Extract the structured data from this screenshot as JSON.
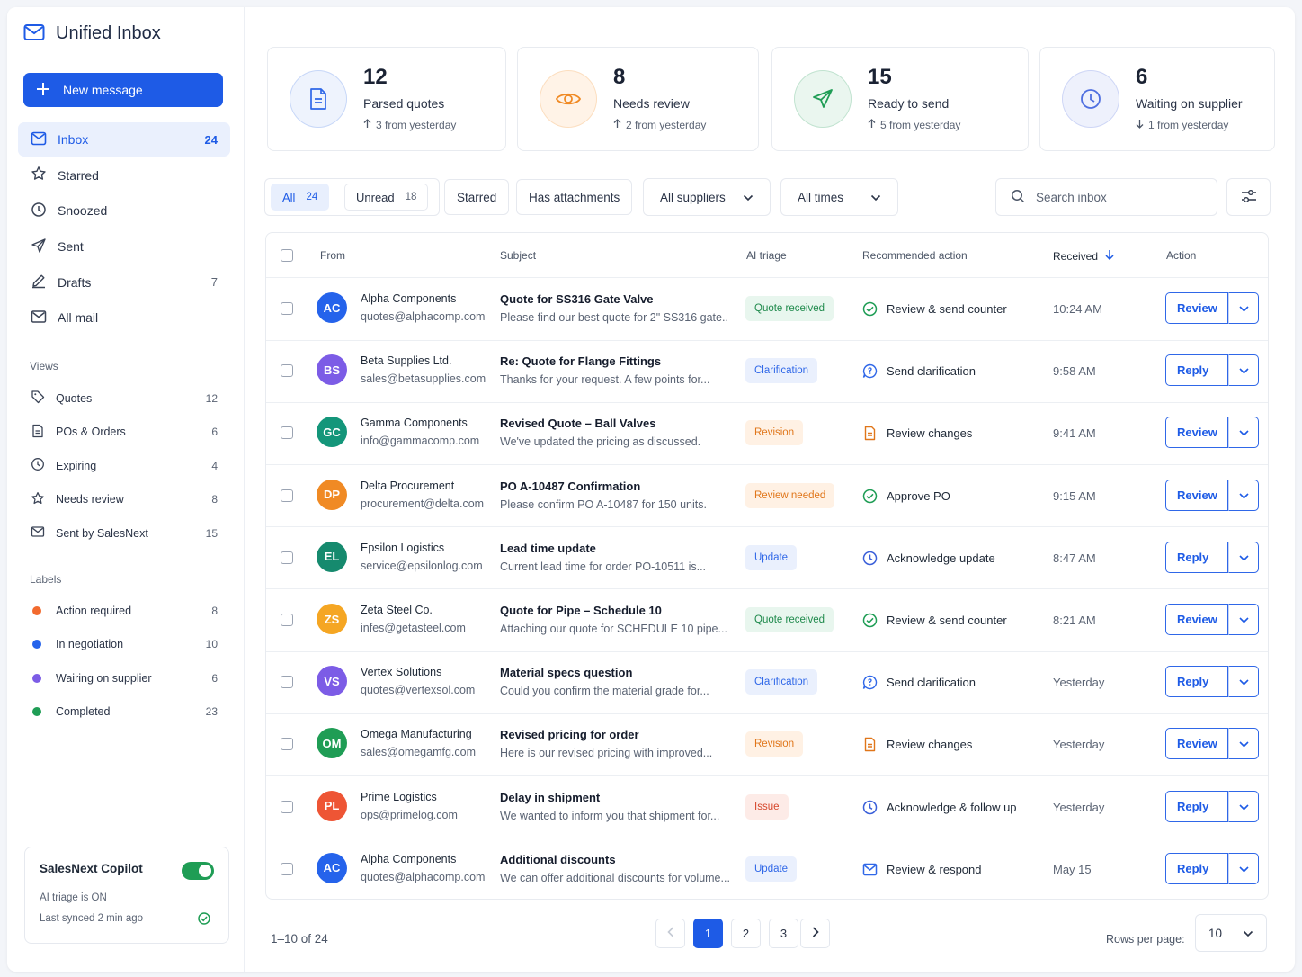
{
  "app": {
    "title": "Unified Inbox",
    "new_message": "New message"
  },
  "nav": [
    {
      "label": "Inbox",
      "count": "24",
      "icon": "inbox-icon"
    },
    {
      "label": "Starred",
      "count": "",
      "icon": "star-icon"
    },
    {
      "label": "Snoozed",
      "count": "",
      "icon": "clock-icon"
    },
    {
      "label": "Sent",
      "count": "",
      "icon": "send-icon"
    },
    {
      "label": "Drafts",
      "count": "7",
      "icon": "pencil-icon"
    },
    {
      "label": "All mail",
      "count": "",
      "icon": "mail-icon"
    }
  ],
  "views": {
    "title": "Views",
    "items": [
      {
        "label": "Quotes",
        "count": "12"
      },
      {
        "label": "POs & Orders",
        "count": "6"
      },
      {
        "label": "Expiring",
        "count": "4"
      },
      {
        "label": "Needs review",
        "count": "8"
      },
      {
        "label": "Sent by SalesNext",
        "count": "15"
      }
    ]
  },
  "labels": {
    "title": "Labels",
    "items": [
      {
        "label": "Action required",
        "count": "8",
        "color": "#f26a2e"
      },
      {
        "label": "In negotiation",
        "count": "10",
        "color": "#2563eb"
      },
      {
        "label": "Wairing on supplier",
        "count": "6",
        "color": "#7c5ce6"
      },
      {
        "label": "Completed",
        "count": "23",
        "color": "#1f9d55"
      }
    ]
  },
  "copilot": {
    "title": "SalesNext Copilot",
    "status": "AI triage is ON",
    "synced": "Last synced 2 min ago",
    "enabled": true
  },
  "stats": [
    {
      "value": "12",
      "label": "Parsed quotes",
      "delta": "3 from yesterday",
      "direction": "up",
      "icon": "document-icon",
      "color": "#2f67e8"
    },
    {
      "value": "8",
      "label": "Needs review",
      "delta": "2 from yesterday",
      "direction": "up",
      "icon": "eye-icon",
      "color": "#f08a24"
    },
    {
      "value": "15",
      "label": "Ready to send",
      "delta": "5 from yesterday",
      "direction": "up",
      "icon": "paper-plane-icon",
      "color": "#1f9d55"
    },
    {
      "value": "6",
      "label": "Waiting on supplier",
      "delta": "1 from yesterday",
      "direction": "down",
      "icon": "clock-icon",
      "color": "#4f6fe0"
    }
  ],
  "filters": {
    "all": {
      "label": "All",
      "count": "24"
    },
    "unread": {
      "label": "Unread",
      "count": "18"
    },
    "starred": "Starred",
    "attachments": "Has attachments",
    "suppliers": "All suppliers",
    "times": "All times",
    "search_placeholder": "Search inbox"
  },
  "columns": {
    "from": "From",
    "subject": "Subject",
    "triage": "AI triage",
    "action": "Recommended action",
    "received": "Received",
    "button": "Action"
  },
  "rows": [
    {
      "initials": "AC",
      "avatar": "#2563eb",
      "name": "Alpha Components",
      "email": "quotes@alphacomp.com",
      "subject": "Quote for SS316 Gate Valve",
      "preview": "Please find our best quote for 2\" SS316 gate...",
      "tag": "Quote received",
      "tag_type": "green",
      "action_icon": "check-circle-icon",
      "action": "Review & send counter",
      "received": "10:24 AM",
      "button": "Review"
    },
    {
      "initials": "BS",
      "avatar": "#7c5ce6",
      "name": "Beta Supplies Ltd.",
      "email": "sales@betasupplies.com",
      "subject": "Re: Quote for Flange Fittings",
      "preview": "Thanks for your request. A few points for...",
      "tag": "Clarification",
      "tag_type": "blue",
      "action_icon": "chat-icon",
      "action": "Send clarification",
      "received": "9:58 AM",
      "button": "Reply"
    },
    {
      "initials": "GC",
      "avatar": "#14967a",
      "name": "Gamma Components",
      "email": "info@gammacomp.com",
      "subject": "Revised Quote – Ball Valves",
      "preview": "We've updated the pricing as discussed.",
      "tag": "Revision",
      "tag_type": "orange",
      "action_icon": "document-icon",
      "action": "Review changes",
      "received": "9:41 AM",
      "button": "Review"
    },
    {
      "initials": "DP",
      "avatar": "#f08a24",
      "name": "Delta Procurement",
      "email": "procurement@delta.com",
      "subject": "PO A-10487 Confirmation",
      "preview": "Please confirm PO A-10487 for 150 units.",
      "tag": "Review needed",
      "tag_type": "orange",
      "action_icon": "check-circle-icon",
      "action": "Approve PO",
      "received": "9:15 AM",
      "button": "Review"
    },
    {
      "initials": "EL",
      "avatar": "#168a6e",
      "name": "Epsilon Logistics",
      "email": "service@epsilonlog.com",
      "subject": "Lead time update",
      "preview": "Current lead time for order PO-10511 is...",
      "tag": "Update",
      "tag_type": "blue",
      "action_icon": "clock-icon",
      "action": "Acknowledge update",
      "received": "8:47 AM",
      "button": "Reply"
    },
    {
      "initials": "ZS",
      "avatar": "#f5a623",
      "name": "Zeta Steel Co.",
      "email": "infes@getasteel.com",
      "subject": "Quote for Pipe – Schedule 10",
      "preview": "Attaching our quote for SCHEDULE 10 pipe...",
      "tag": "Quote received",
      "tag_type": "green",
      "action_icon": "check-circle-icon",
      "action": "Review & send counter",
      "received": "8:21 AM",
      "button": "Review"
    },
    {
      "initials": "VS",
      "avatar": "#7c5ce6",
      "name": "Vertex Solutions",
      "email": "quotes@vertexsol.com",
      "subject": "Material specs question",
      "preview": "Could you confirm the material grade for...",
      "tag": "Clarification",
      "tag_type": "blue",
      "action_icon": "chat-icon",
      "action": "Send clarification",
      "received": "Yesterday",
      "button": "Reply"
    },
    {
      "initials": "OM",
      "avatar": "#1f9d55",
      "name": "Omega Manufacturing",
      "email": "sales@omegamfg.com",
      "subject": "Revised pricing for order",
      "preview": "Here is our revised pricing with improved...",
      "tag": "Revision",
      "tag_type": "orange",
      "action_icon": "document-icon",
      "action": "Review changes",
      "received": "Yesterday",
      "button": "Review"
    },
    {
      "initials": "PL",
      "avatar": "#ee5535",
      "name": "Prime Logistics",
      "email": "ops@primelog.com",
      "subject": "Delay in shipment",
      "preview": "We wanted to inform you that shipment for...",
      "tag": "Issue",
      "tag_type": "red",
      "action_icon": "clock-icon",
      "action": "Acknowledge & follow up",
      "received": "Yesterday",
      "button": "Reply"
    },
    {
      "initials": "AC",
      "avatar": "#2563eb",
      "name": "Alpha Components",
      "email": "quotes@alphacomp.com",
      "subject": "Additional discounts",
      "preview": "We can offer additional discounts for volume...",
      "tag": "Update",
      "tag_type": "blue",
      "action_icon": "mail-icon",
      "action": "Review & respond",
      "received": "May 15",
      "button": "Reply"
    }
  ],
  "pagination": {
    "range": "1–10 of 24",
    "pages": [
      "1",
      "2",
      "3"
    ],
    "current": "1",
    "rows_label": "Rows per page:",
    "rows_value": "10"
  }
}
